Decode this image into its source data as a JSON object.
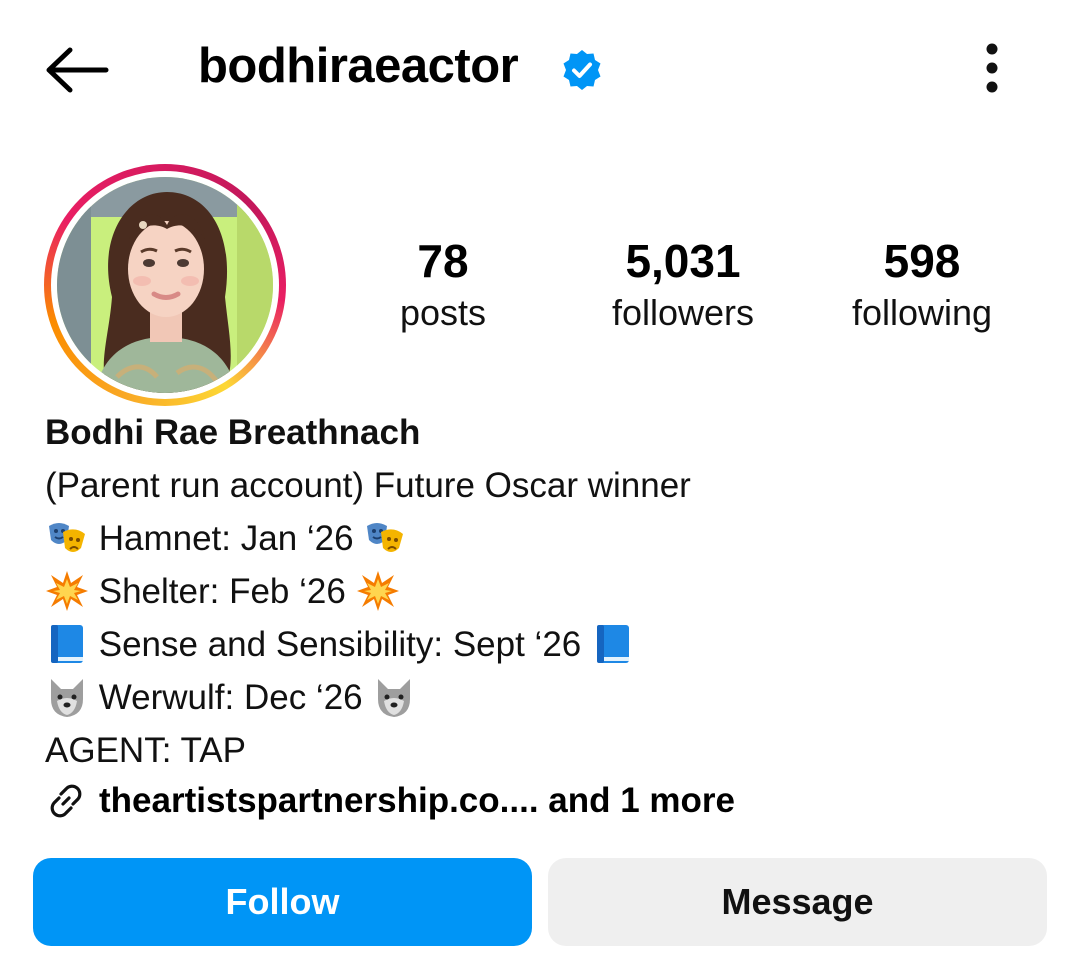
{
  "header": {
    "username": "bodhiraeactor",
    "verified": true,
    "back_icon": "arrow-left-icon",
    "more_icon": "vertical-dots-icon"
  },
  "profile": {
    "avatar_alt": "profile-photo",
    "ring_colors": [
      "#f9a825",
      "#e91e63",
      "#c2185b"
    ],
    "stats": [
      {
        "value": "78",
        "label": "posts"
      },
      {
        "value": "5,031",
        "label": "followers"
      },
      {
        "value": "598",
        "label": "following"
      }
    ],
    "display_name": "Bodhi Rae Breathnach",
    "bio_line": "(Parent run account) Future Oscar winner",
    "projects": [
      {
        "emoji": "performing-arts-icon",
        "text": "Hamnet: Jan ‘26"
      },
      {
        "emoji": "collision-icon",
        "text": "Shelter: Feb ‘26"
      },
      {
        "emoji": "blue-book-icon",
        "text": "Sense and Sensibility: Sept ‘26"
      },
      {
        "emoji": "wolf-icon",
        "text": "Werwulf: Dec ‘26"
      }
    ],
    "agent_line": "AGENT: TAP",
    "link_text": "theartistspartnership.co.... and 1 more"
  },
  "actions": {
    "follow_label": "Follow",
    "message_label": "Message"
  },
  "colors": {
    "accent": "#0095f6",
    "secondary_button": "#efefef",
    "verified": "#0095f6"
  }
}
